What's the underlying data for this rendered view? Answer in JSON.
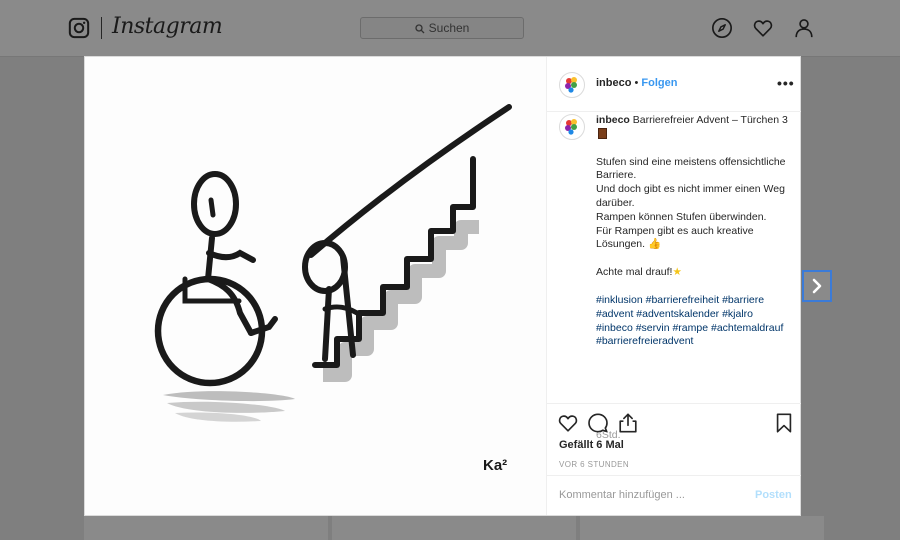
{
  "topbar": {
    "wordmark": "Instagram",
    "search_placeholder": "Suchen",
    "icons": [
      "instagram-camera-icon",
      "compass-icon",
      "heart-icon",
      "profile-icon"
    ]
  },
  "post": {
    "username": "inbeco",
    "follow_label": "Folgen",
    "more_label": "•••",
    "caption": {
      "title": "Barrierefreier Advent – Türchen 3",
      "lines1": [
        "Stufen sind eine meistens offensichtliche Barriere.",
        "Und doch gibt es nicht immer einen Weg darüber.",
        "Rampen können Stufen überwinden.",
        "Für Rampen gibt es auch kreative Lösungen."
      ],
      "line2": "Achte mal drauf!",
      "hashtags": "#inklusion #barrierefreiheit #barriere #advent #adventskalender #kjalro #inbeco #servin #rampe #achtemaldrauf #barrierefreieradvent",
      "time": "6Std."
    },
    "likes": "Gefällt 6 Mal",
    "ago": "VOR 6 STUNDEN",
    "comment_placeholder": "Kommentar hinzufügen ...",
    "post_label": "Posten",
    "signature": "Ka²"
  },
  "colors": {
    "accent": "#3897f0",
    "hashtag": "#003569",
    "post_disabled": "#b2dffc"
  }
}
